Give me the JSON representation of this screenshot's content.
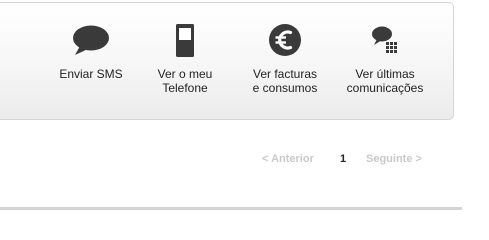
{
  "actions": [
    {
      "id": "send-sms",
      "icon": "speech-bubble-icon",
      "label_lines": [
        "Enviar SMS"
      ]
    },
    {
      "id": "view-phone",
      "icon": "mobile-phone-icon",
      "label_lines": [
        "Ver o meu",
        "Telefone"
      ]
    },
    {
      "id": "view-bills",
      "icon": "euro-icon",
      "label_lines": [
        "Ver facturas",
        "e consumos"
      ]
    },
    {
      "id": "view-comms",
      "icon": "chat-keypad-icon",
      "label_lines": [
        "Ver últimas",
        "comunicações"
      ]
    }
  ],
  "pagination": {
    "previous": "< Anterior",
    "current_page": "1",
    "next": "Seguinte >"
  },
  "colors": {
    "icon": "#3a3a3a",
    "text": "#222222",
    "disabled_link": "#c9c9c9",
    "panel_border": "#d6d6d6"
  }
}
